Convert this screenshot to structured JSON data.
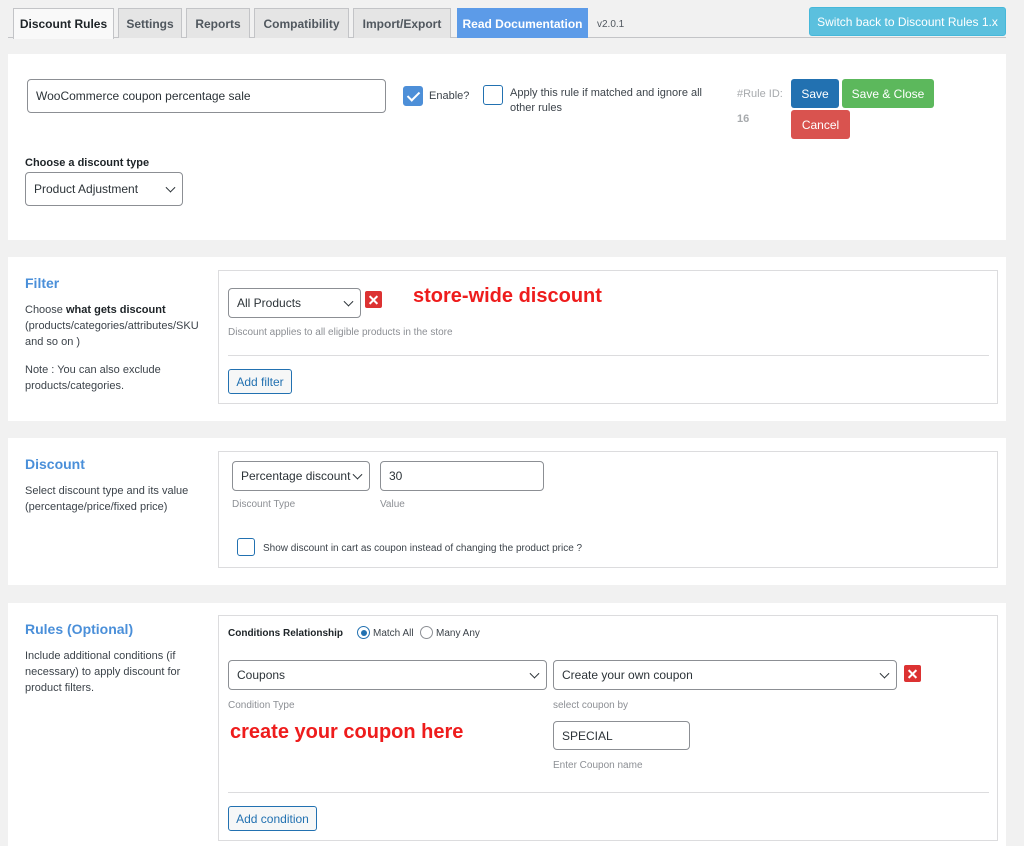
{
  "tabs": [
    {
      "label": "Discount Rules",
      "active": true
    },
    {
      "label": "Settings"
    },
    {
      "label": "Reports"
    },
    {
      "label": "Compatibility"
    },
    {
      "label": "Import/Export"
    },
    {
      "label": "Read Documentation"
    }
  ],
  "version": "v2.0.1",
  "switch_button": "Switch back to Discount Rules 1.x",
  "rule": {
    "name_value": "WooCommerce coupon percentage sale",
    "enable_label": "Enable?",
    "enable_checked": true,
    "apply_label": "Apply this rule if matched and ignore all other rules",
    "apply_checked": false,
    "rule_id_label": "#Rule ID:",
    "rule_id": "16",
    "save": "Save",
    "save_close": "Save & Close",
    "cancel": "Cancel",
    "discount_type_label": "Choose a discount type",
    "discount_type_value": "Product Adjustment"
  },
  "filter": {
    "title": "Filter",
    "desc_prefix": "Choose ",
    "desc_bold": "what gets discount",
    "desc_rest": "(products/categories/attributes/SKU and so on )",
    "note": "Note : You can also exclude products/categories.",
    "select_value": "All Products",
    "hint": "Discount applies to all eligible products in the store",
    "add_filter": "Add filter",
    "annotation": "store-wide discount"
  },
  "discount": {
    "title": "Discount",
    "desc": "Select discount type and its value (percentage/price/fixed price)",
    "type_value": "Percentage discount",
    "value": "30",
    "type_label": "Discount Type",
    "value_label": "Value",
    "coupon_label": "Show discount in cart as coupon instead of changing the product price ?"
  },
  "rules": {
    "title": "Rules (Optional)",
    "desc": "Include additional conditions (if necessary) to apply discount for product filters.",
    "relationship_label": "Conditions Relationship",
    "match_all": "Match All",
    "many_any": "Many Any",
    "condition_value": "Coupons",
    "coupon_mode_value": "Create your own coupon",
    "condition_type_label": "Condition Type",
    "select_coupon_by_label": "select coupon by",
    "coupon_name_value": "SPECIAL",
    "coupon_name_label": "Enter Coupon name",
    "add_condition": "Add condition",
    "annotation": "create your coupon here"
  },
  "colors": {
    "accent": "#4a8fd9",
    "save": "#2271b1",
    "save_close": "#5cb85c",
    "cancel": "#d9534f",
    "annotation": "#ee1c1c"
  }
}
